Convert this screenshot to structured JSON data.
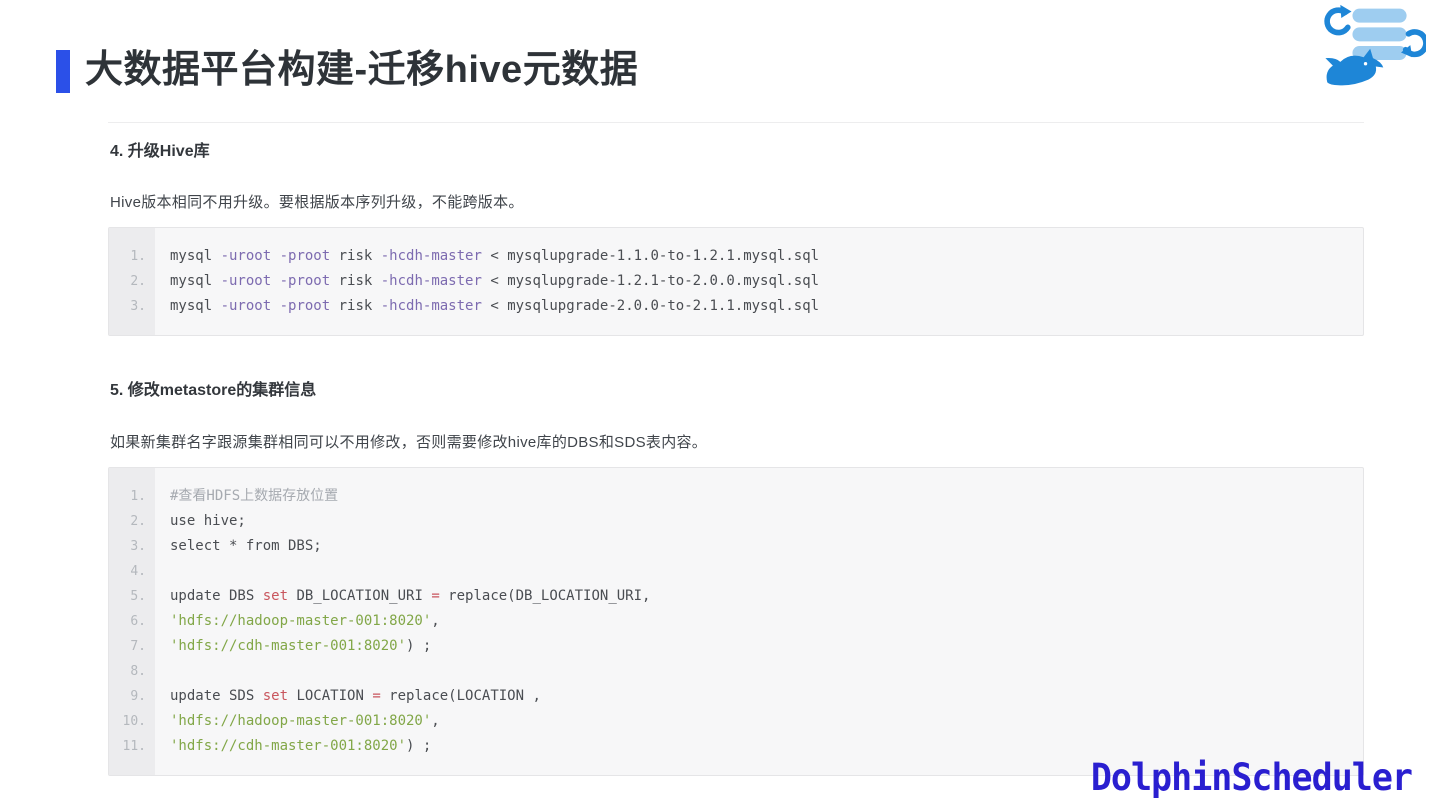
{
  "page": {
    "title": "大数据平台构建-迁移hive元数据",
    "brand": "DolphinScheduler"
  },
  "colors": {
    "accent_blue": "#2b50e8",
    "brand_blue": "#2a1fd0",
    "logo_light_blue": "#9ecdf0",
    "logo_blue": "#1e86d7",
    "code_flag_purple": "#7d6bb0",
    "code_keyword_red": "#c9565e",
    "code_string_green": "#82a748",
    "code_comment_gray": "#a6aab0"
  },
  "sections": [
    {
      "heading": "4. 升级Hive库",
      "paragraph": "Hive版本相同不用升级。要根据版本序列升级，不能跨版本。",
      "code": {
        "lines": [
          [
            {
              "t": "mysql ",
              "c": "plain"
            },
            {
              "t": "-uroot",
              "c": "flag"
            },
            {
              "t": " ",
              "c": "plain"
            },
            {
              "t": "-proot",
              "c": "flag"
            },
            {
              "t": " risk ",
              "c": "plain"
            },
            {
              "t": "-hcdh-master",
              "c": "flag"
            },
            {
              "t": " < mysqlupgrade-1.1.0-to-1.2.1.mysql.sql",
              "c": "plain"
            }
          ],
          [
            {
              "t": "mysql ",
              "c": "plain"
            },
            {
              "t": "-uroot",
              "c": "flag"
            },
            {
              "t": " ",
              "c": "plain"
            },
            {
              "t": "-proot",
              "c": "flag"
            },
            {
              "t": " risk ",
              "c": "plain"
            },
            {
              "t": "-hcdh-master",
              "c": "flag"
            },
            {
              "t": " < mysqlupgrade-1.2.1-to-2.0.0.mysql.sql",
              "c": "plain"
            }
          ],
          [
            {
              "t": "mysql ",
              "c": "plain"
            },
            {
              "t": "-uroot",
              "c": "flag"
            },
            {
              "t": " ",
              "c": "plain"
            },
            {
              "t": "-proot",
              "c": "flag"
            },
            {
              "t": " risk ",
              "c": "plain"
            },
            {
              "t": "-hcdh-master",
              "c": "flag"
            },
            {
              "t": " < mysqlupgrade-2.0.0-to-2.1.1.mysql.sql",
              "c": "plain"
            }
          ]
        ]
      }
    },
    {
      "heading": "5. 修改metastore的集群信息",
      "paragraph": "如果新集群名字跟源集群相同可以不用修改，否则需要修改hive库的DBS和SDS表内容。",
      "code": {
        "lines": [
          [
            {
              "t": "#查看HDFS上数据存放位置",
              "c": "comment"
            }
          ],
          [
            {
              "t": "use hive;",
              "c": "plain"
            }
          ],
          [
            {
              "t": "select * from DBS;",
              "c": "plain"
            }
          ],
          [],
          [
            {
              "t": "update DBS ",
              "c": "plain"
            },
            {
              "t": "set",
              "c": "kw"
            },
            {
              "t": " DB_LOCATION_URI ",
              "c": "plain"
            },
            {
              "t": "=",
              "c": "kw"
            },
            {
              "t": " replace(DB_LOCATION_URI,",
              "c": "plain"
            }
          ],
          [
            {
              "t": "'hdfs://hadoop-master-001:8020'",
              "c": "str"
            },
            {
              "t": ",",
              "c": "plain"
            }
          ],
          [
            {
              "t": "'hdfs://cdh-master-001:8020'",
              "c": "str"
            },
            {
              "t": ") ;",
              "c": "plain"
            }
          ],
          [],
          [
            {
              "t": "update SDS ",
              "c": "plain"
            },
            {
              "t": "set",
              "c": "kw"
            },
            {
              "t": " LOCATION ",
              "c": "plain"
            },
            {
              "t": "=",
              "c": "kw"
            },
            {
              "t": " replace(LOCATION ,",
              "c": "plain"
            }
          ],
          [
            {
              "t": "'hdfs://hadoop-master-001:8020'",
              "c": "str"
            },
            {
              "t": ",",
              "c": "plain"
            }
          ],
          [
            {
              "t": "'hdfs://cdh-master-001:8020'",
              "c": "str"
            },
            {
              "t": ") ;",
              "c": "plain"
            }
          ]
        ]
      }
    }
  ]
}
